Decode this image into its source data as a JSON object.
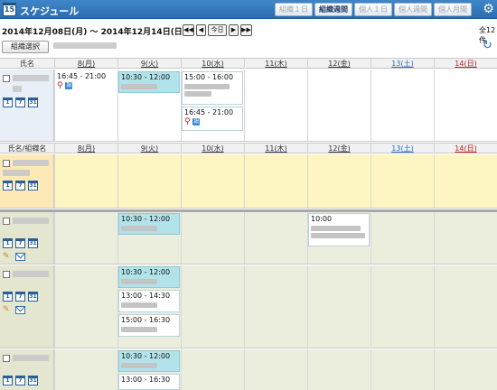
{
  "app": {
    "icon_number": "15",
    "title": "スケジュール"
  },
  "views": [
    {
      "label": "組織１日",
      "active": false
    },
    {
      "label": "組織週間",
      "active": true
    },
    {
      "label": "個人１日",
      "active": false
    },
    {
      "label": "個人週間",
      "active": false
    },
    {
      "label": "個人月間",
      "active": false
    }
  ],
  "gear_icon": "gear-icon",
  "date_range": "2014年12月08日(月) ～ 2014年12月14日(日)",
  "nav": {
    "prev_week": "◀◀",
    "prev_day": "◀",
    "today": "今日",
    "next_day": "▶",
    "next_week": "▶▶"
  },
  "total": "全12件",
  "group_select": {
    "label": "組織選択"
  },
  "header1": {
    "name": "氏名",
    "days": [
      "8(月)",
      "9(火)",
      "10(水)",
      "11(木)",
      "12(金)",
      "13(土)",
      "14(日)"
    ]
  },
  "header2": {
    "name": "氏名/組織名",
    "days": [
      "8(月)",
      "9(火)",
      "10(水)",
      "11(木)",
      "12(金)",
      "13(土)",
      "14(日)"
    ]
  },
  "cal_icons": [
    "1",
    "7",
    "31"
  ],
  "events": {
    "e1": {
      "time": "16:45 - 21:00"
    },
    "e2": {
      "time": "10:30 - 12:00"
    },
    "e3": {
      "time": "15:00 - 16:00"
    },
    "e4": {
      "time": "16:45 - 21:00"
    },
    "e5": {
      "time": "10:30 - 12:00"
    },
    "e6": {
      "time": "10:00"
    },
    "e7": {
      "time": "10:30 - 12:00"
    },
    "e8": {
      "time": "13:00 - 14:30"
    },
    "e9": {
      "time": "15:00 - 16:30"
    },
    "e10": {
      "time": "10:30 - 12:00"
    },
    "e11": {
      "time": "13:00 - 16:30"
    }
  },
  "colors": {
    "titlebar": "#2f78bf",
    "highlight_event": "#b3e3ea",
    "org_row": "#fdf6c2",
    "member_row": "#eceedd",
    "name_self": "#e9eff7",
    "saturday": "#2b6fc4",
    "sunday": "#c02020"
  }
}
